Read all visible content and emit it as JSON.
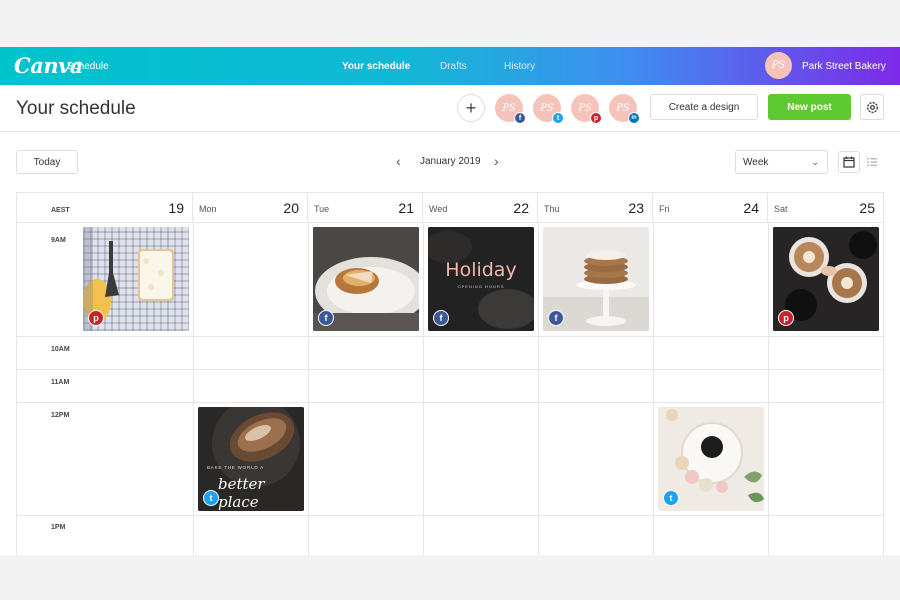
{
  "app": {
    "logo": "Canva",
    "section": "Schedule",
    "nav": [
      {
        "label": "Your schedule",
        "active": true
      },
      {
        "label": "Drafts",
        "active": false
      },
      {
        "label": "History",
        "active": false
      }
    ],
    "account": {
      "initials": "PS",
      "name": "Park Street Bakery"
    }
  },
  "header": {
    "title": "Your schedule",
    "profiles": [
      {
        "initials": "PS",
        "network": "facebook-icon",
        "glyph": "f",
        "color": "#3b5998"
      },
      {
        "initials": "PS",
        "network": "twitter-icon",
        "glyph": "t",
        "color": "#1da1f2"
      },
      {
        "initials": "PS",
        "network": "pinterest-icon",
        "glyph": "p",
        "color": "#c8232c"
      },
      {
        "initials": "PS",
        "network": "linkedin-icon",
        "glyph": "in",
        "color": "#0077b5"
      }
    ],
    "create_label": "Create a design",
    "new_post_label": "New post"
  },
  "toolbar": {
    "today_label": "Today",
    "month_label": "January 2019",
    "view_value": "Week"
  },
  "calendar": {
    "timezone": "AEST",
    "days": [
      {
        "name": "",
        "date": "19"
      },
      {
        "name": "Mon",
        "date": "20"
      },
      {
        "name": "Tue",
        "date": "21"
      },
      {
        "name": "Wed",
        "date": "22"
      },
      {
        "name": "Thu",
        "date": "23"
      },
      {
        "name": "Fri",
        "date": "24"
      },
      {
        "name": "Sat",
        "date": "25"
      }
    ],
    "times": [
      "9AM",
      "10AM",
      "11AM",
      "12PM",
      "1PM"
    ],
    "posts": [
      {
        "day": 0,
        "slot": "9AM",
        "network": "pinterest",
        "image": "cake-slice-photo"
      },
      {
        "day": 2,
        "slot": "9AM",
        "network": "facebook",
        "image": "pastry-plate-photo"
      },
      {
        "day": 3,
        "slot": "9AM",
        "network": "facebook",
        "image": "holiday-graphic",
        "text": "Holiday",
        "subtext": "OPENING HOURS"
      },
      {
        "day": 4,
        "slot": "9AM",
        "network": "facebook",
        "image": "pancake-stack-photo"
      },
      {
        "day": 6,
        "slot": "9AM",
        "network": "pinterest",
        "image": "coffee-cups-photo"
      },
      {
        "day": 1,
        "slot": "12PM",
        "network": "twitter",
        "image": "bread-loaf-graphic",
        "subtext": "BAKE THE WORLD A",
        "text": "better place"
      },
      {
        "day": 5,
        "slot": "12PM",
        "network": "twitter",
        "image": "macarons-coffee-photo"
      }
    ]
  },
  "colors": {
    "gradient_start": "#00c4cc",
    "gradient_end": "#7d2ae8",
    "new_post_green": "#5ec931",
    "avatar_pink": "#f6c3bb",
    "facebook": "#3b5998",
    "twitter": "#1da1f2",
    "pinterest": "#c8232c"
  }
}
